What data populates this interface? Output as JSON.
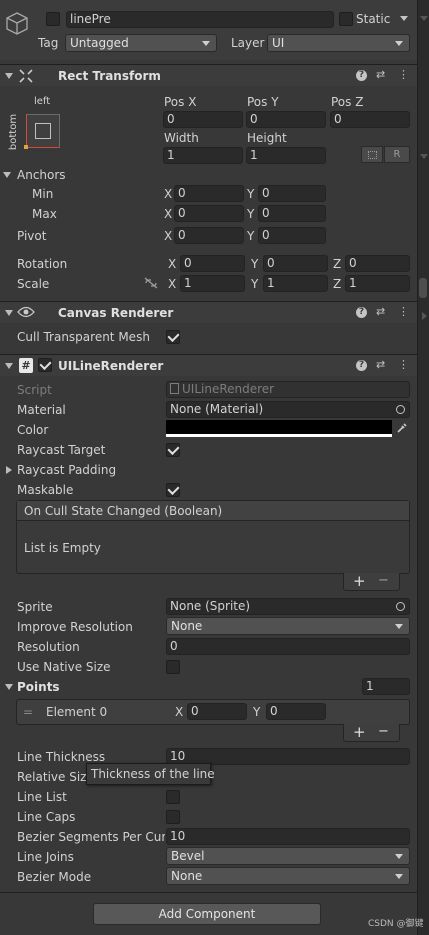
{
  "object": {
    "name": "linePre",
    "static_label": "Static",
    "tag_label": "Tag",
    "tag_value": "Untagged",
    "layer_label": "Layer",
    "layer_value": "UI"
  },
  "rect_transform": {
    "title": "Rect Transform",
    "anchor_h": "left",
    "anchor_v": "bottom",
    "pos_x_label": "Pos X",
    "pos_x": "0",
    "pos_y_label": "Pos Y",
    "pos_y": "0",
    "pos_z_label": "Pos Z",
    "pos_z": "0",
    "width_label": "Width",
    "width": "1",
    "height_label": "Height",
    "height": "1",
    "r_button": "R",
    "anchors_label": "Anchors",
    "min_label": "Min",
    "min_x": "0",
    "min_y": "0",
    "max_label": "Max",
    "max_x": "0",
    "max_y": "0",
    "pivot_label": "Pivot",
    "pivot_x": "0",
    "pivot_y": "0",
    "rotation_label": "Rotation",
    "rot_x": "0",
    "rot_y": "0",
    "rot_z": "0",
    "scale_label": "Scale",
    "scale_x": "1",
    "scale_y": "1",
    "scale_z": "1",
    "x": "X",
    "y": "Y",
    "z": "Z"
  },
  "canvas_renderer": {
    "title": "Canvas Renderer",
    "cull_label": "Cull Transparent Mesh",
    "cull_checked": true
  },
  "ui_line_renderer": {
    "title": "UILineRenderer",
    "script_label": "Script",
    "script_value": "UILineRenderer",
    "material_label": "Material",
    "material_value": "None (Material)",
    "color_label": "Color",
    "color_value": "#000000",
    "raycast_target_label": "Raycast Target",
    "raycast_padding_label": "Raycast Padding",
    "maskable_label": "Maskable",
    "event_title": "On Cull State Changed (Boolean)",
    "event_empty": "List is Empty",
    "plus": "+",
    "minus": "−",
    "sprite_label": "Sprite",
    "sprite_value": "None (Sprite)",
    "improve_label": "Improve Resolution",
    "improve_value": "None",
    "resolution_label": "Resolution",
    "resolution_value": "0",
    "native_label": "Use Native Size",
    "points_label": "Points",
    "points_count": "1",
    "element_label": "Element 0",
    "el_x": "0",
    "el_y": "0",
    "thickness_label": "Line Thickness",
    "thickness_value": "10",
    "relative_label": "Relative Size",
    "tooltip": "Thickness of the line",
    "linelist_label": "Line List",
    "linecaps_label": "Line Caps",
    "bezier_seg_label": "Bezier Segments Per Curv",
    "bezier_seg_value": "10",
    "joins_label": "Line Joins",
    "joins_value": "Bevel",
    "bezier_mode_label": "Bezier Mode",
    "bezier_mode_value": "None"
  },
  "add_component": "Add Component",
  "watermark": "CSDN @御键"
}
